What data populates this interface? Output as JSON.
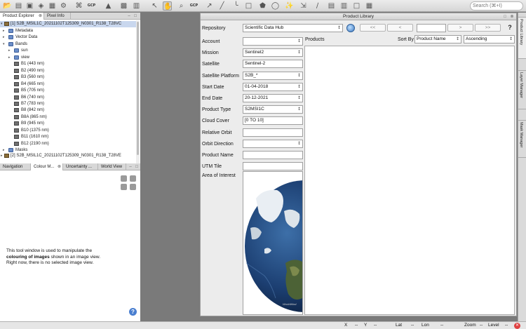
{
  "toolbar": {
    "icons": [
      "open-icon",
      "save-icon",
      "import-icon",
      "export-icon",
      "layers-icon",
      "gcp-icon",
      "pin-icon",
      "grid-icon",
      "cursor-icon",
      "zoom-icon",
      "pan-icon",
      "gcp-tool-icon",
      "line-icon",
      "polygon-icon",
      "ellipse-icon",
      "magic-wand-icon",
      "range-icon",
      "measure-icon",
      "window-icon"
    ],
    "gcp_label": "GCP",
    "search_placeholder": "Search (⌘+I)"
  },
  "left_panel": {
    "tabs": [
      {
        "label": "Product Explorer",
        "active": true
      },
      {
        "label": "Pixel Info",
        "active": false
      }
    ],
    "product_top": "[1] S2B_MSIL1C_20211102T125309_N0301_R138_T28VC",
    "tree": [
      {
        "label": "Metadata",
        "kind": "folder",
        "level": 1
      },
      {
        "label": "Vector Data",
        "kind": "folder",
        "level": 1
      },
      {
        "label": "Bands",
        "kind": "folder",
        "level": 1,
        "open": true
      },
      {
        "label": "sun",
        "kind": "folder",
        "level": 2
      },
      {
        "label": "view",
        "kind": "folder",
        "level": 2
      },
      {
        "label": "B1 (443 nm)",
        "kind": "band",
        "level": 2
      },
      {
        "label": "B2 (490 nm)",
        "kind": "band",
        "level": 2
      },
      {
        "label": "B3 (560 nm)",
        "kind": "band",
        "level": 2
      },
      {
        "label": "B4 (665 nm)",
        "kind": "band",
        "level": 2
      },
      {
        "label": "B5 (705 nm)",
        "kind": "band",
        "level": 2
      },
      {
        "label": "B6 (740 nm)",
        "kind": "band",
        "level": 2
      },
      {
        "label": "B7 (783 nm)",
        "kind": "band",
        "level": 2
      },
      {
        "label": "B8 (842 nm)",
        "kind": "band",
        "level": 2
      },
      {
        "label": "B8A (865 nm)",
        "kind": "band",
        "level": 2
      },
      {
        "label": "B9 (945 nm)",
        "kind": "band",
        "level": 2
      },
      {
        "label": "B10 (1375 nm)",
        "kind": "band",
        "level": 2
      },
      {
        "label": "B11 (1610 nm)",
        "kind": "band",
        "level": 2
      },
      {
        "label": "B12 (2190 nm)",
        "kind": "band",
        "level": 2
      },
      {
        "label": "Masks",
        "kind": "folder",
        "level": 1
      }
    ],
    "product_bottom": "[2] S2B_MSIL1C_20211102T125309_N0301_R138_T28VE",
    "bottom_tabs": [
      {
        "label": "Navigation",
        "active": false
      },
      {
        "label": "Colour M...",
        "active": true
      },
      {
        "label": "Uncertainty ...",
        "active": false
      },
      {
        "label": "World View",
        "active": false
      }
    ],
    "colour_msg_pre": "This tool window is used to manipulate the",
    "colour_msg_bold": "colouring of images",
    "colour_msg_post": "shown in an image view.",
    "colour_msg_line3": "Right now, there is no selected image view."
  },
  "product_library": {
    "title": "Product Library",
    "repository_label": "Repository",
    "repository_value": "Scientific Data Hub",
    "nav_first": "<<",
    "nav_prev": "<",
    "nav_next": ">",
    "nav_last": ">>",
    "help": "?",
    "products_label": "Products",
    "sort_by_label": "Sort By",
    "sort_by_value": "Product Name",
    "sort_order_value": "Ascending",
    "fields": [
      {
        "label": "Account",
        "value": "",
        "combo": true
      },
      {
        "label": "Mission",
        "value": "Sentinel2",
        "combo": true
      },
      {
        "label": "Satellite",
        "value": "Sentinel-2",
        "combo": false
      },
      {
        "label": "Satellite Platform",
        "value": "S2B_*",
        "combo": true
      },
      {
        "label": "Start Date",
        "value": "01-04-2018",
        "combo": true
      },
      {
        "label": "End Date",
        "value": "20-12-2021",
        "combo": true
      },
      {
        "label": "Product Type",
        "value": "S2MSI1C",
        "combo": true
      },
      {
        "label": "Cloud Cover",
        "value": "[0 TO 10]",
        "combo": false
      },
      {
        "label": "Relative Orbit",
        "value": "",
        "combo": false
      },
      {
        "label": "Orbit Direction",
        "value": "",
        "combo": true
      },
      {
        "label": "Product Name",
        "value": "",
        "combo": false
      },
      {
        "label": "UTM Tile",
        "value": "",
        "combo": false
      }
    ],
    "aoi_label": "Area of Interest",
    "globe_credit": "WorldWind"
  },
  "right_tabs": [
    {
      "label": "Product Library",
      "active": true
    },
    {
      "label": "Layer Manager",
      "active": false
    },
    {
      "label": "Mask Manager",
      "active": false
    }
  ],
  "status": {
    "x_label": "X",
    "x_value": "--",
    "y_label": "Y",
    "y_value": "--",
    "lat_label": "Lat",
    "lat_value": "--",
    "lon_label": "Lon",
    "lon_value": "--",
    "zoom_label": "Zoom",
    "zoom_value": "--",
    "level_label": "Level",
    "level_value": "--"
  }
}
